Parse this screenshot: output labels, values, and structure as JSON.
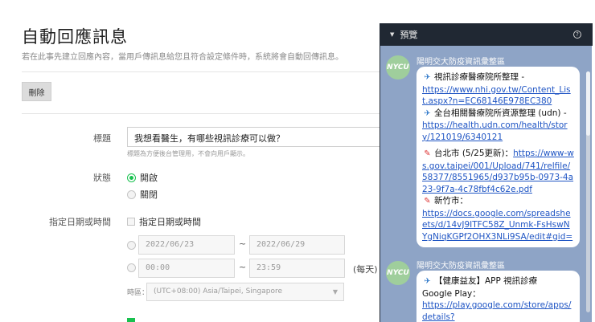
{
  "page": {
    "title": "自動回應訊息",
    "description": "若在此事先建立回應內容，當用戶傳訊息給您且符合設定條件時，系統將會自動回傳訊息。",
    "delete_label": "刪除"
  },
  "form": {
    "title_label": "標題",
    "title_value": "我想看醫生，有哪些視訊診療可以做？",
    "title_hint": "標題為方便後台管理用，不會向用戶顯示。",
    "status_label": "狀態",
    "status_on": "開啟",
    "status_off": "關閉",
    "datetime_label": "指定日期或時間",
    "datetime_checkbox": "指定日期或時間",
    "date_from": "2022/06/23",
    "date_to": "2022/06/29",
    "time_from": "00:00",
    "time_to": "23:59",
    "tilde": "~",
    "daily": "(每天)",
    "timezone_label": "時區：",
    "timezone_value": "(UTC+08:00) Asia/Taipei, Singapore"
  },
  "preview": {
    "title": "預覽",
    "sender": "陽明交大防疫資訊彙整區",
    "avatar_text": "NYCU",
    "msg1": {
      "line1": "視訊診療醫療院所整理 -",
      "link1": "https://www.nhi.gov.tw/Content_List.aspx?n=EC68146E978EC380",
      "line2": "全台相關醫療院所資源整理 (udn) -",
      "link2": "https://health.udn.com/health/story/121019/6340121",
      "line3": "台北市 (5/25更新)：",
      "link3": "https://www-ws.gov.taipei/001/Upload/741/relfile/58377/8551965/d937b95b-0973-4a23-9f7a-4c78fbf4c62e.pdf",
      "line4": "新竹市：",
      "link4": "https://docs.google.com/spreadsheets/d/14vJ9ITFC58Z_Unmk-FsHswNYgNiqKGPf2OHX3NLi9SA/edit#gid="
    },
    "msg2": {
      "line1": "【健康益友】APP 視訊診療",
      "line2": "Google Play：",
      "link1": "https://play.google.com/store/apps/details?"
    }
  },
  "colors": {
    "accent_green": "#19c14f",
    "panel_bg": "#8ea4c6",
    "panel_header": "#202833",
    "link": "#1f55c4"
  },
  "icons": [
    "collapse-arrow-icon",
    "help-icon",
    "megaphone-icon",
    "pin-icon"
  ]
}
